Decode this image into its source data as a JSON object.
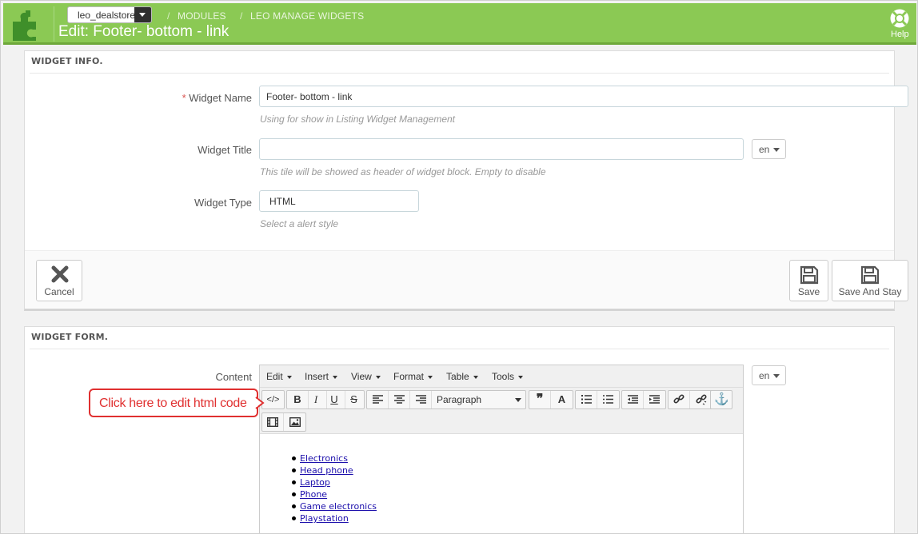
{
  "header": {
    "shop_select": "leo_dealstore",
    "breadcrumb": [
      "MODULES",
      "LEO MANAGE WIDGETS"
    ],
    "breadcrumb_sep": "/",
    "title": "Edit: Footer- bottom - link",
    "help_label": "Help"
  },
  "widget_info": {
    "heading": "WIDGET INFO.",
    "required_mark": "*",
    "name_label": "Widget Name",
    "name_value": "Footer- bottom - link",
    "name_help": "Using for show in Listing Widget Management",
    "title_label": "Widget Title",
    "title_value": "",
    "title_help": "This tile will be showed as header of widget block. Empty to disable",
    "lang": "en",
    "type_label": "Widget Type",
    "type_value": "HTML",
    "type_help": "Select a alert style",
    "cancel_label": "Cancel",
    "save_label": "Save",
    "save_stay_label": "Save And Stay"
  },
  "widget_form": {
    "heading": "WIDGET FORM.",
    "content_label": "Content",
    "lang": "en",
    "menu": [
      "Edit",
      "Insert",
      "View",
      "Format",
      "Table",
      "Tools"
    ],
    "format_select": "Paragraph",
    "content_items": [
      "Electronics",
      "Head phone",
      "Laptop",
      "Phone",
      "Game electronics",
      "Playstation"
    ]
  },
  "annotation": {
    "text": "Click here to edit html code",
    "color": "#e03030"
  },
  "colors": {
    "header_bg": "#8bc954",
    "link": "#1a0dab"
  }
}
